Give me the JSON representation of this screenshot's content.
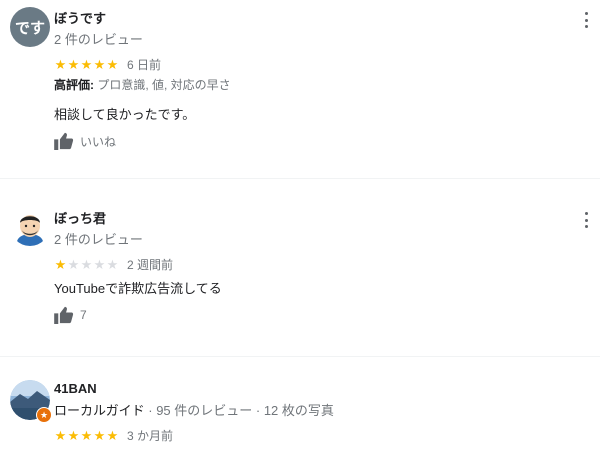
{
  "colors": {
    "star": "#fbbc04",
    "star_empty": "#dadce0",
    "secondary": "#70757a",
    "thumb": "#5f6368"
  },
  "reviews": [
    {
      "avatar_text": "です",
      "name": "ぼうです",
      "meta": "2 件のレビュー",
      "rating": 5,
      "date": "6 日前",
      "attr_label": "高評価:",
      "attr_value": "プロ意識, 値, 対応の早さ",
      "text": "相談して良かったです。",
      "like_label": "いいね",
      "like_icon": "thumbs-up-icon"
    },
    {
      "avatar_icon": "illustrated-person-avatar",
      "name": "ぼっち君",
      "meta": "2 件のレビュー",
      "rating": 1,
      "date": "2 週間前",
      "text": "YouTubeで詐欺広告流してる",
      "like_count": "7",
      "like_icon": "thumbs-up-icon"
    },
    {
      "avatar_icon": "landscape-photo-avatar",
      "badge_icon": "local-guide-star-badge",
      "name": "41BAN",
      "guide_label": "ローカルガイド",
      "meta": "· 95 件のレビュー · 12 枚の写真",
      "rating": 5,
      "date": "3 か月前"
    }
  ]
}
